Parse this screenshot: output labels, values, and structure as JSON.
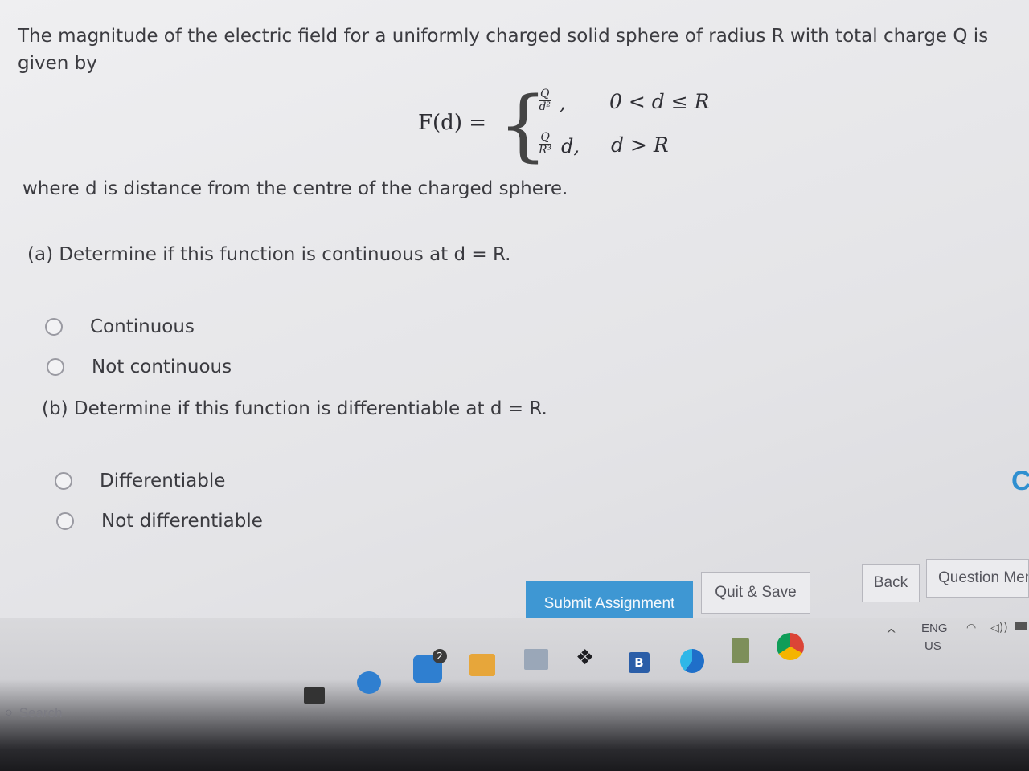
{
  "question": {
    "intro": "The magnitude of the electric field for a uniformly charged solid sphere of radius R with total charge Q is given by",
    "formula": {
      "lhs": "F(d) =",
      "case1_num": "Q",
      "case1_den": "d²",
      "case1_tail": ",",
      "case1_cond": "0 < d ≤ R",
      "case2_num": "Q",
      "case2_den": "R³",
      "case2_tail": "d,",
      "case2_cond": "d > R"
    },
    "where": "where d is distance from the centre of the charged sphere."
  },
  "part_a": {
    "prompt": "(a) Determine if this function is continuous at d = R.",
    "options": [
      "Continuous",
      "Not continuous"
    ]
  },
  "part_b": {
    "prompt": "(b) Determine if this function is differentiable at d = R.",
    "options": [
      "Differentiable",
      "Not differentiable"
    ]
  },
  "buttons": {
    "submit": "Submit Assignment",
    "quit_save": "Quit & Save",
    "back": "Back",
    "question_menu": "Question Menu"
  },
  "taskbar": {
    "search": "Search",
    "lang": "ENG",
    "region": "US",
    "badge": "2",
    "b_app": "B",
    "icons": [
      "folder-icon",
      "chat-icon",
      "store-icon",
      "files-icon",
      "calculator-icon",
      "dropbox-icon",
      "b-app-icon",
      "edge-icon",
      "notes-icon",
      "chrome-icon"
    ]
  },
  "colors": {
    "primary_button": "#3e97d3",
    "partial_c": "#2f8fd0"
  },
  "partial_letter": "C"
}
